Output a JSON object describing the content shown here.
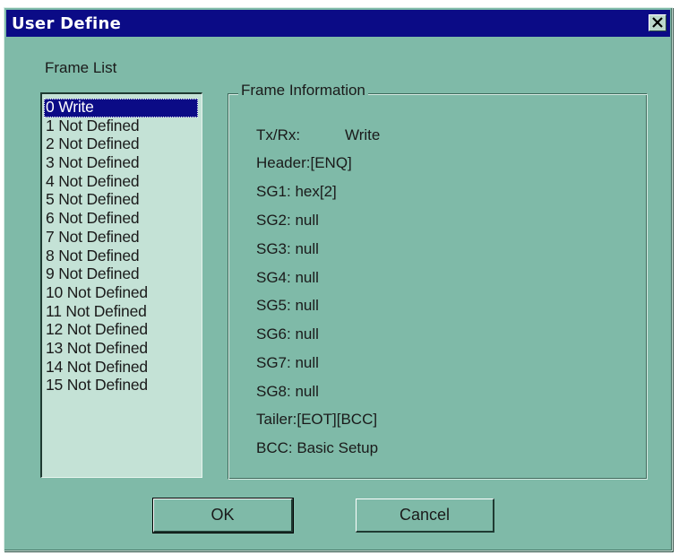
{
  "window": {
    "title": "User Define"
  },
  "frame_list": {
    "label": "Frame List",
    "items": [
      "0 Write",
      "1 Not Defined",
      "2 Not Defined",
      "3 Not Defined",
      "4 Not Defined",
      "5 Not Defined",
      "6 Not Defined",
      "7 Not Defined",
      "8 Not Defined",
      "9 Not Defined",
      "10 Not Defined",
      "11 Not Defined",
      "12 Not Defined",
      "13 Not Defined",
      "14 Not Defined",
      "15 Not Defined"
    ],
    "selected_index": 0
  },
  "frame_info": {
    "title": "Frame Information",
    "txrx_label": "Tx/Rx:",
    "txrx_value": "Write",
    "header": "Header:[ENQ]",
    "sg1": "SG1: hex[2]",
    "sg2": "SG2: null",
    "sg3": "SG3: null",
    "sg4": "SG4: null",
    "sg5": "SG5: null",
    "sg6": "SG6: null",
    "sg7": "SG7: null",
    "sg8": "SG8: null",
    "tailer": "Tailer:[EOT][BCC]",
    "bcc": "BCC: Basic Setup"
  },
  "buttons": {
    "ok": "OK",
    "cancel": "Cancel"
  },
  "icons": {
    "close": "close-icon"
  },
  "colors": {
    "dialog_bg": "#7fbaa8",
    "titlebar_bg": "#0b0b86",
    "listbox_bg": "#c4e2d6",
    "selection_bg": "#0b0b86"
  }
}
